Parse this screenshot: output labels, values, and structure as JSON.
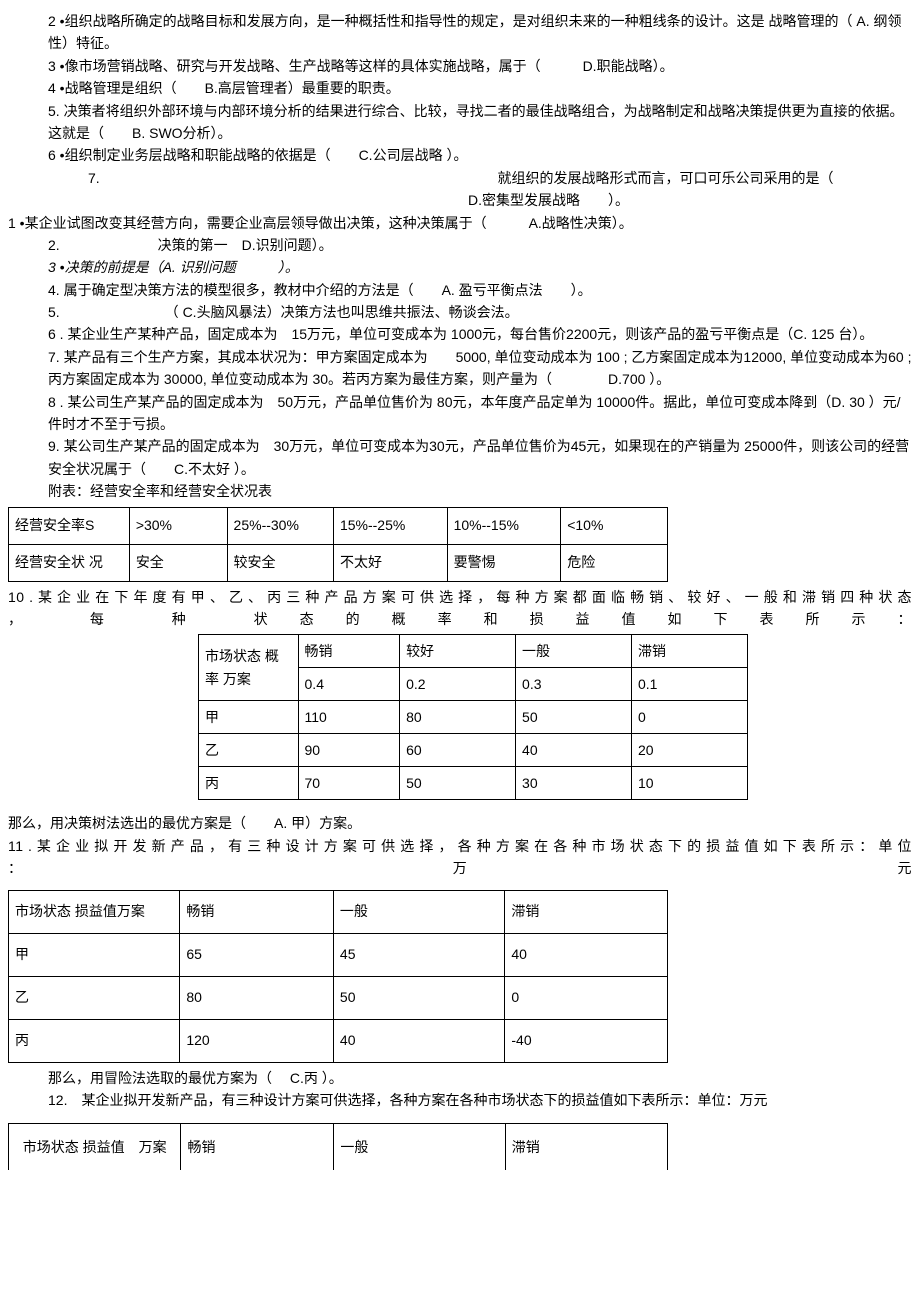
{
  "p": {
    "q2": "2 •组织战略所确定的战略目标和发展方向，是一种概括性和指导性的规定，是对组织未来的一种粗线条的设计。这是 战略管理的（ A. 纲领性）特征。",
    "q3": "3 •像市场营销战略、研究与开发战略、生产战略等这样的具体实施战略，属于（　　　D.职能战略）。",
    "q4": "4 •战略管理是组织（　　B.高层管理者）最重要的职责。",
    "q5": "5. 决策者将组织外部环境与内部环境分析的结果进行综合、比较，寻找二者的最佳战略组合，为战略制定和战略决策提供更为直接的依据。这就是（　　B. SWO分析）。",
    "q6": "6 •组织制定业务层战略和职能战略的依据是（　　C.公司层战略  ）。",
    "q7a": "7.",
    "q7b": "就组织的发展战略形式而言，可口可乐公司采用的是（",
    "q7c": "D.密集型发展战略　　）。",
    "q1b": "1 •某企业试图改变其经营方向，需要企业高层领导做出决策，这种决策属于（　　　A.战略性决策）。",
    "q2b": "2.　　　　　　　决策的第一　D.识别问题）。",
    "q3b": "3 •决策的前提是（A. 识别问题　　　）。",
    "q4b": "4. 属于确定型决策方法的模型很多，教材中介绍的方法是（　　A. 盈亏平衡点法　　）。",
    "q5b": "5.　　　　　　　　（ C.头脑风暴法）决策方法也叫思维共振法、畅谈会法。",
    "q6b": "6 . 某企业生产某种产品，固定成本为　15万元，单位可变成本为 1000元，每台售价2200元，则该产品的盈亏平衡点是（C. 125 台）。",
    "q7_2": "7. 某产品有三个生产方案，其成本状况为：甲方案固定成本为　　5000, 单位变动成本为 100 ; 乙方案固定成本为12000, 单位变动成本为60 ; 丙方案固定成本为 30000, 单位变动成本为 30。若丙方案为最佳方案，则产量为（　　　　D.700 ）。",
    "q8b": "8  . 某公司生产某产品的固定成本为　50万元，产品单位售价为 80元，本年度产品定单为 10000件。据此，单位可变成本降到（D. 30 ）元/件时才不至于亏损。",
    "q9b": "9. 某公司生产某产品的固定成本为　30万元，单位可变成本为30元，产品单位售价为45元，如果现在的产销量为 25000件，则该公司的经营安全状况属于（　　C.不太好  ）。",
    "attach": "附表：经营安全率和经营安全状况表",
    "q10": "10 . 某 企 业 在 下 年 度 有 甲 、 乙 、 丙 三 种 产 品 方 案 可 供 选 择 ， 每 种 方 案 都 面 临 畅 销 、 较 好 、 一 般 和 滞 销 四 种 状 态 ， 每 种 状态的概率和损益值如下表所示：",
    "q10ans": "那么，用决策树法选出的最优方案是（　　A. 甲）方案。",
    "q11": "11 . 某 企 业 拟 开 发 新 产 品 ， 有 三 种 设 计 方 案 可 供 选 择 ， 各 种 方 案 在 各 种 市 场 状 态 下 的 损 益 值 如 下 表 所 示 ： 单 位 ： 万 元",
    "q11ans": "那么，用冒险法选取的最优方案为（　 C.丙 ）。",
    "q12": "12.　某企业拟开发新产品，有三种设计方案可供选择，各种方案在各种市场状态下的损益值如下表所示：单位：万元"
  },
  "t1": {
    "r1": [
      "经营安全率S",
      ">30%",
      "25%--30%",
      "15%--25%",
      "10%--15%",
      "<10%"
    ],
    "r2": [
      "经营安全状  况",
      "安全",
      "较安全",
      "不太好",
      "要警惕",
      "危险"
    ]
  },
  "t2": {
    "h1": "市场状态  概率 万案",
    "hc": [
      "畅销",
      "较好",
      "一般",
      "滞销"
    ],
    "pr": [
      "0.4",
      "0.2",
      "0.3",
      "0.1"
    ],
    "rows": [
      [
        "甲",
        "110",
        "80",
        "50",
        "0"
      ],
      [
        "乙",
        "90",
        "60",
        "40",
        "20"
      ],
      [
        "丙",
        "70",
        "50",
        "30",
        "10"
      ]
    ]
  },
  "t3": {
    "h1": "市场状态  损益值万案",
    "hc": [
      "畅销",
      "一般",
      "滞销"
    ],
    "rows": [
      [
        "甲",
        "65",
        "45",
        "40"
      ],
      [
        "乙",
        "80",
        "50",
        "0"
      ],
      [
        "丙",
        "120",
        "40",
        "-40"
      ]
    ]
  },
  "t4": {
    "h1": "市场状态  损益值　万案",
    "hc": [
      "畅销",
      "一般",
      "滞销"
    ]
  }
}
